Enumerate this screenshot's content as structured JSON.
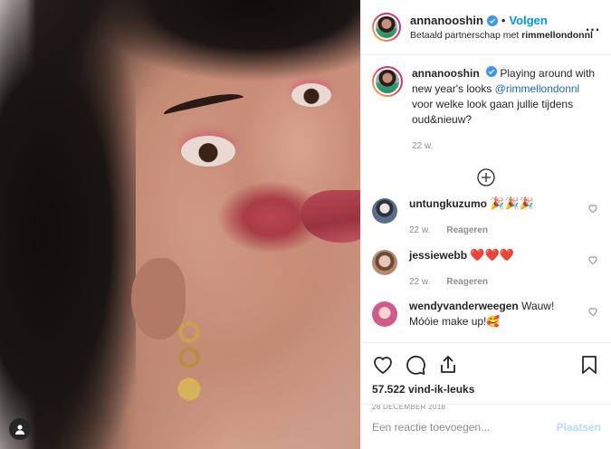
{
  "header": {
    "username": "annanooshin",
    "follow_label": "Volgen",
    "separator": "•",
    "partnership_prefix": "Betaald partnerschap met ",
    "partner": "rimmellondonnl",
    "more_label": "..."
  },
  "caption": {
    "username": "annanooshin",
    "text_before": "Playing around with new year's looks ",
    "mention": "@rimmellondonnl",
    "text_after": " voor welke look gaan jullie tijdens oud&nieuw?",
    "time": "22 w."
  },
  "comments": [
    {
      "username": "untungkuzumo",
      "text": "🎉🎉🎉",
      "time": "22 w.",
      "reply": "Reageren",
      "avatar_color": "#5a6e8a"
    },
    {
      "username": "jessiewebb",
      "text": "❤️❤️❤️",
      "time": "22 w.",
      "reply": "Reageren",
      "avatar_color": "#b58a6e"
    },
    {
      "username": "wendyvanderweegen",
      "text": "Wauw! Móóie make up!🥰",
      "time": "",
      "reply": "",
      "avatar_color": "#d05a8c"
    }
  ],
  "actions": {
    "likes": "57.522 vind-ik-leuks",
    "date": "28 DECEMBER 2018"
  },
  "add_comment": {
    "placeholder": "Een reactie toevoegen...",
    "post_label": "Plaatsen"
  },
  "colors": {
    "accent": "#0095f6",
    "muted": "#8e8e8e",
    "text": "#262626"
  }
}
